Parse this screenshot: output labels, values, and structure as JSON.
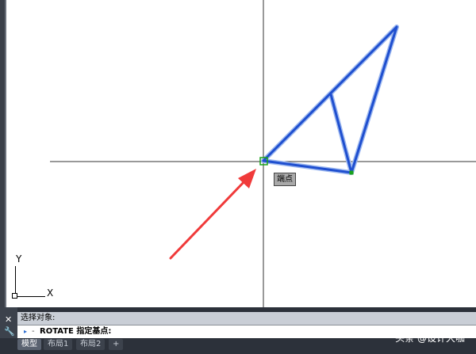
{
  "canvas": {
    "background": "#ffffff",
    "crosshair_color": "#333333",
    "line_color": "#1f4fcf",
    "highlight_color": "#9db8f0",
    "arrow_color": "#f03a3a",
    "grip_color": "#1aa31a"
  },
  "ucs_icon": {
    "y_label": "Y",
    "x_label": "X"
  },
  "tooltip": {
    "text": "端点"
  },
  "command": {
    "history_text": "选择对象:",
    "prompt_text": "ROTATE 指定基点:",
    "prompt_dash": "-",
    "close_icon": "close-icon",
    "wrench_icon": "wrench-icon"
  },
  "tabs": {
    "items": [
      {
        "label": "模型",
        "active": true
      },
      {
        "label": "布局1",
        "active": false
      },
      {
        "label": "布局2",
        "active": false
      },
      {
        "label": "+",
        "active": false
      }
    ]
  },
  "watermark": {
    "text": "头条 @设计大咖"
  }
}
